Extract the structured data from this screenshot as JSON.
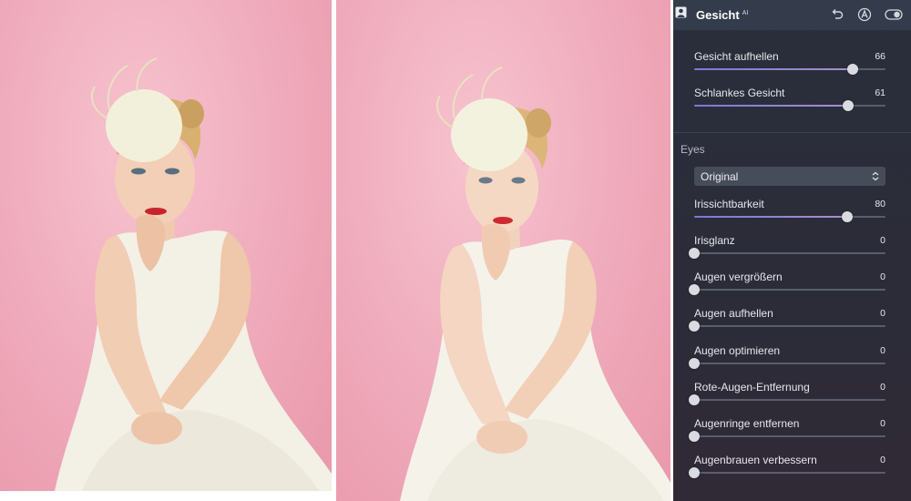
{
  "panel": {
    "title": "Gesicht",
    "title_badge": "AI",
    "icons": {
      "portrait": "portrait-icon",
      "undo": "undo-icon",
      "auto": "auto-adjust-icon",
      "toggle": "visibility-toggle-icon"
    }
  },
  "face_sliders": [
    {
      "label": "Gesicht aufhellen",
      "value": "66",
      "level": 66,
      "min": -100,
      "max": 100
    },
    {
      "label": "Schlankes Gesicht",
      "value": "61",
      "level": 61,
      "min": -100,
      "max": 100
    }
  ],
  "eyes": {
    "section_label": "Eyes",
    "dropdown_value": "Original",
    "sliders": [
      {
        "label": "Irissichtbarkeit",
        "value": "80",
        "level": 80,
        "min": 0,
        "max": 100
      },
      {
        "label": "Irisglanz",
        "value": "0",
        "level": 0,
        "min": 0,
        "max": 100
      },
      {
        "label": "Augen vergrößern",
        "value": "0",
        "level": 0,
        "min": 0,
        "max": 100
      },
      {
        "label": "Augen aufhellen",
        "value": "0",
        "level": 0,
        "min": 0,
        "max": 100
      },
      {
        "label": "Augen optimieren",
        "value": "0",
        "level": 0,
        "min": 0,
        "max": 100
      },
      {
        "label": "Rote-Augen-Entfernung",
        "value": "0",
        "level": 0,
        "min": 0,
        "max": 100
      },
      {
        "label": "Augenringe entfernen",
        "value": "0",
        "level": 0,
        "min": 0,
        "max": 100
      },
      {
        "label": "Augenbrauen verbessern",
        "value": "0",
        "level": 0,
        "min": 0,
        "max": 100
      }
    ]
  },
  "colors": {
    "panel_bg": "#2b2e3a",
    "header_bg": "#343b4a",
    "accent": "#8e84d8",
    "photo_bg": "#f0aebe"
  }
}
